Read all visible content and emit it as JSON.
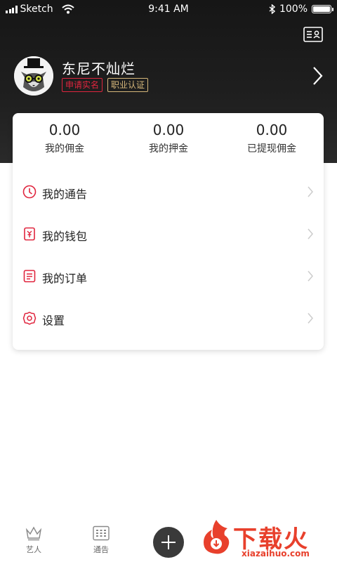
{
  "status_bar": {
    "carrier": "Sketch",
    "time": "9:41 AM",
    "battery": "100%",
    "battery_level": 1.0
  },
  "profile": {
    "name": "东尼不灿烂",
    "tags": [
      "申请实名",
      "职业认证"
    ]
  },
  "stats": [
    {
      "value": "0.00",
      "label": "我的佣金"
    },
    {
      "value": "0.00",
      "label": "我的押金"
    },
    {
      "value": "0.00",
      "label": "已提现佣金"
    }
  ],
  "menu": [
    {
      "label": "我的通告",
      "icon": "clock-icon"
    },
    {
      "label": "我的钱包",
      "icon": "wallet-icon"
    },
    {
      "label": "我的订单",
      "icon": "order-list-icon"
    },
    {
      "label": "设置",
      "icon": "gear-icon"
    }
  ],
  "tabs": [
    {
      "label": "艺人",
      "icon": "crown-icon"
    },
    {
      "label": "通告",
      "icon": "calendar-grid-icon"
    }
  ],
  "watermark": {
    "text": "下载火",
    "url": "xiazaihuo.com"
  },
  "colors": {
    "accent": "#e0253e",
    "gold": "#d6b77a",
    "header": "#1a1a1a",
    "watermark": "#e8402c"
  }
}
